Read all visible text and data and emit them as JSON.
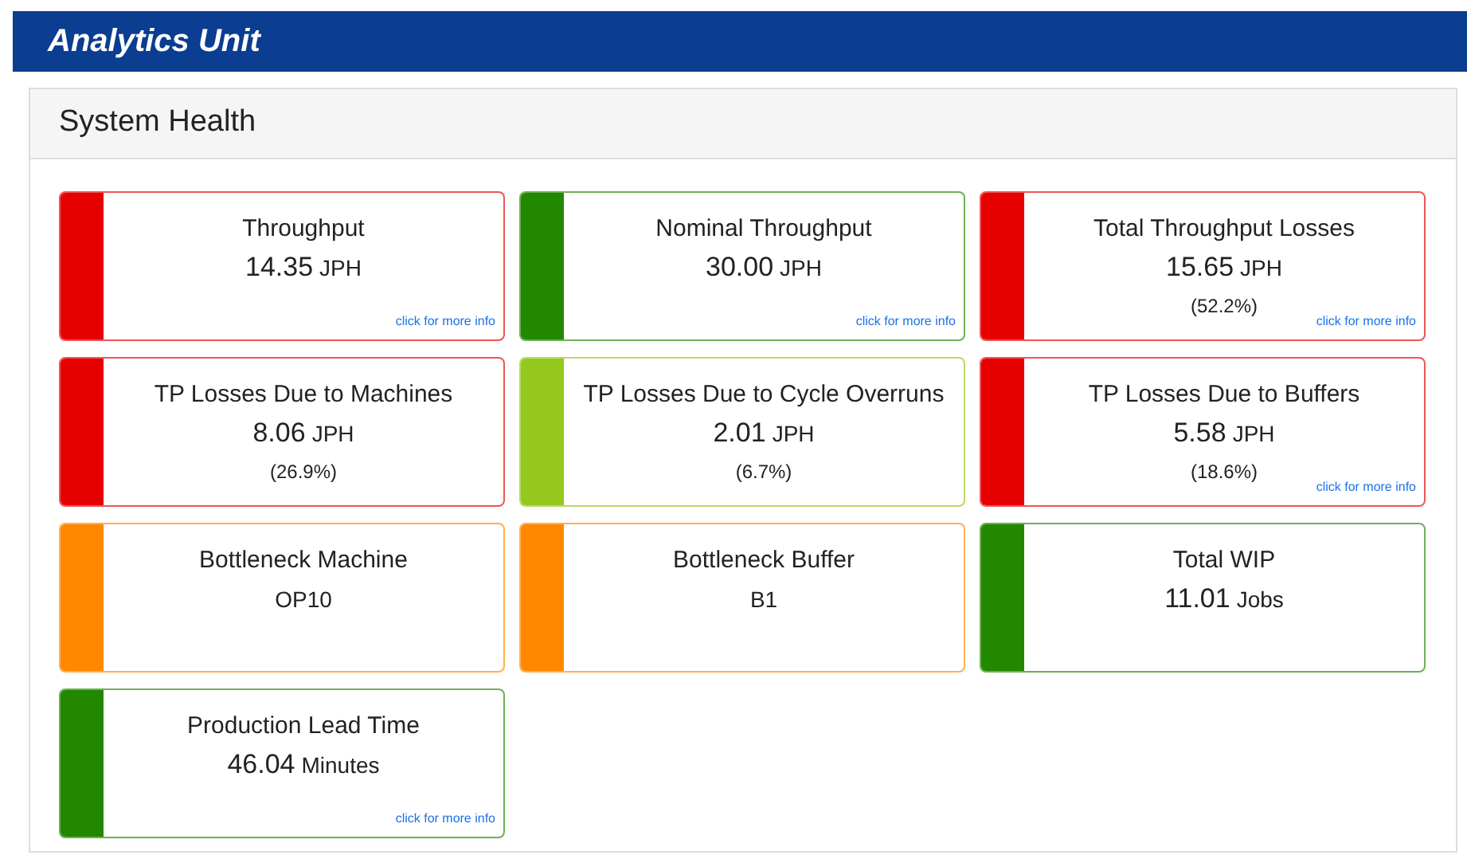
{
  "header": {
    "title": "Analytics Unit"
  },
  "panel": {
    "title": "System Health"
  },
  "cards": [
    {
      "title": "Throughput",
      "value": "14.35",
      "unit": "JPH",
      "color": "#e60000",
      "link": "click for more info"
    },
    {
      "title": "Nominal Throughput",
      "value": "30.00",
      "unit": "JPH",
      "color": "#228800",
      "link": "click for more info"
    },
    {
      "title": "Total Throughput Losses",
      "value": "15.65",
      "unit": "JPH",
      "percent": "(52.2%)",
      "color": "#e60000",
      "link": "click for more info"
    },
    {
      "title": "TP Losses Due to Machines",
      "value": "8.06",
      "unit": "JPH",
      "percent": "(26.9%)",
      "color": "#e60000"
    },
    {
      "title": "TP Losses Due to Cycle Overruns",
      "value": "2.01",
      "unit": "JPH",
      "percent": "(6.7%)",
      "color": "#95c81c"
    },
    {
      "title": "TP Losses Due to Buffers",
      "value": "5.58",
      "unit": "JPH",
      "percent": "(18.6%)",
      "color": "#e60000",
      "link": "click for more info"
    },
    {
      "title": "Bottleneck Machine",
      "value": "OP10",
      "color": "#ff8800"
    },
    {
      "title": "Bottleneck Buffer",
      "value": "B1",
      "color": "#ff8800"
    },
    {
      "title": "Total WIP",
      "value": "11.01",
      "unit": "Jobs",
      "color": "#228800"
    },
    {
      "title": "Production Lead Time",
      "value": "46.04",
      "unit": "Minutes",
      "color": "#228800",
      "link": "click for more info"
    }
  ]
}
